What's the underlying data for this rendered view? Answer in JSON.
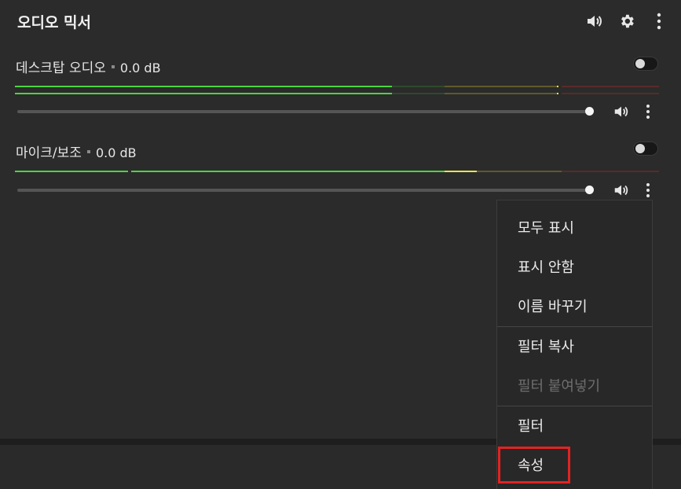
{
  "dock": {
    "title": "오디오 믹서",
    "icons": [
      "speaker-icon",
      "gear-icon",
      "kebab-icon"
    ]
  },
  "sources": [
    {
      "name": "데스크탑 오디오",
      "db": "0.0 dB",
      "enabled": false,
      "volume_fraction": 1.0
    },
    {
      "name": "마이크/보조",
      "db": "0.0 dB",
      "enabled": false,
      "volume_fraction": 1.0
    }
  ],
  "context_menu": {
    "items": [
      {
        "label": "모두 표시",
        "enabled": true
      },
      {
        "label": "표시 안함",
        "enabled": true
      },
      {
        "label": "이름 바꾸기",
        "enabled": true
      },
      {
        "label": "필터 복사",
        "enabled": true
      },
      {
        "label": "필터 붙여넣기",
        "enabled": false
      },
      {
        "label": "필터",
        "enabled": true
      },
      {
        "label": "속성",
        "enabled": true,
        "highlighted": true
      }
    ]
  },
  "colors": {
    "meter_green": "#4cd443",
    "meter_green_dim": "#2f4a2d",
    "meter_yellow": "#e7e34c",
    "meter_yellow_dim": "#5f5a2c",
    "meter_red_dim": "#5a2a2a",
    "highlight": "#e32222"
  }
}
